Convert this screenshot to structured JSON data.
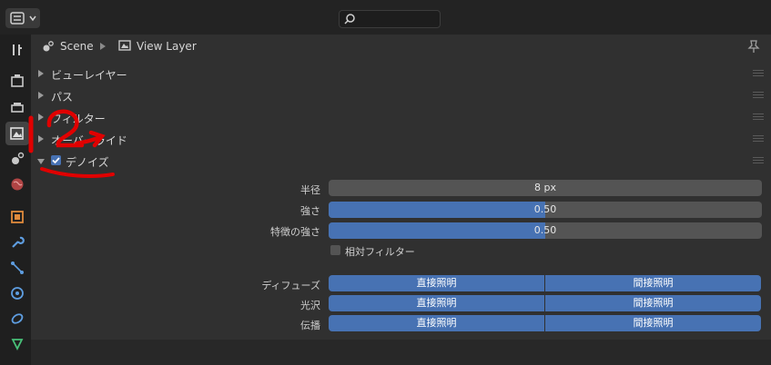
{
  "header": {
    "search_placeholder": ""
  },
  "breadcrumb": {
    "scene": "Scene",
    "view_layer": "View Layer"
  },
  "panels": [
    {
      "label": "ビューレイヤー",
      "expanded": false
    },
    {
      "label": "パス",
      "expanded": false
    },
    {
      "label": "フィルター",
      "expanded": false
    },
    {
      "label": "オーバーライド",
      "expanded": false
    },
    {
      "label": "デノイズ",
      "expanded": true,
      "checked": true
    }
  ],
  "denoise": {
    "radius": {
      "label": "半径",
      "value": "8 px"
    },
    "strength": {
      "label": "強さ",
      "value": "0.50",
      "fraction": 0.5
    },
    "feature_strength": {
      "label": "特徴の強さ",
      "value": "0.50",
      "fraction": 0.5
    },
    "relative_filter": {
      "label": "相対フィルター",
      "checked": false
    },
    "passes": [
      {
        "label": "ディフューズ",
        "direct": "直接照明",
        "indirect": "間接照明"
      },
      {
        "label": "光沢",
        "direct": "直接照明",
        "indirect": "間接照明"
      },
      {
        "label": "伝播",
        "direct": "直接照明",
        "indirect": "間接照明"
      }
    ]
  },
  "colors": {
    "accent": "#4772b3",
    "annotation": "#e00000"
  }
}
